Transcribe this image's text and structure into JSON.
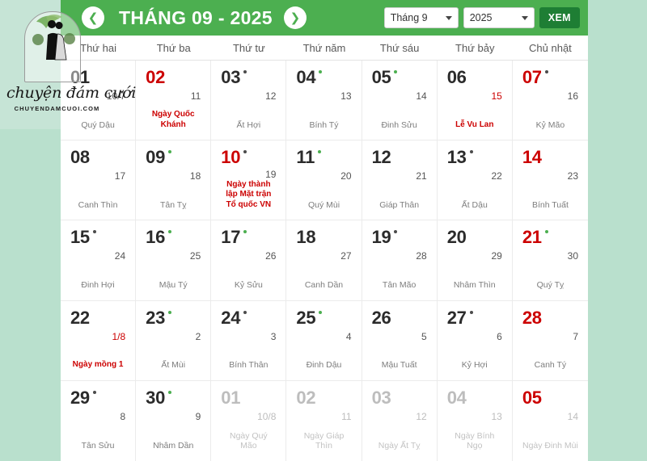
{
  "branding": {
    "script_name": "chuyện đám cưới",
    "website": "CHUYENDAMCUOI.COM",
    "logo_icon": "bride-groom-illustration-icon"
  },
  "header": {
    "title": "THÁNG 09 - 2025",
    "prev_icon": "chevron-left-icon",
    "next_icon": "chevron-right-icon",
    "month_select": "Tháng 9",
    "year_select": "2025",
    "view_button": "XEM",
    "accent_color": "#4caf50",
    "button_color": "#1e7e34"
  },
  "weekdays": [
    "Thứ hai",
    "Thứ ba",
    "Thứ tư",
    "Thứ năm",
    "Thứ sáu",
    "Thứ bảy",
    "Chủ nhật"
  ],
  "days": [
    {
      "solar": "01",
      "lunar": "10/7",
      "note": "Quý Dậu",
      "dot": "none",
      "red": false,
      "red_lunar": false,
      "other": false
    },
    {
      "solar": "02",
      "lunar": "11",
      "note": "Ngày Quốc Khánh",
      "dot": "none",
      "red": true,
      "red_lunar": false,
      "other": false,
      "holiday": true
    },
    {
      "solar": "03",
      "lunar": "12",
      "note": "Ất Hợi",
      "dot": "dark",
      "red": false,
      "red_lunar": false,
      "other": false
    },
    {
      "solar": "04",
      "lunar": "13",
      "note": "Bính Tý",
      "dot": "green",
      "red": false,
      "red_lunar": false,
      "other": false
    },
    {
      "solar": "05",
      "lunar": "14",
      "note": "Đinh Sửu",
      "dot": "green",
      "red": false,
      "red_lunar": false,
      "other": false
    },
    {
      "solar": "06",
      "lunar": "15",
      "note": "Lễ Vu Lan",
      "dot": "none",
      "red": false,
      "red_lunar": true,
      "other": false,
      "holiday": true
    },
    {
      "solar": "07",
      "lunar": "16",
      "note": "Kỷ Mão",
      "dot": "dark",
      "red": true,
      "red_lunar": false,
      "other": false
    },
    {
      "solar": "08",
      "lunar": "17",
      "note": "Canh Thìn",
      "dot": "none",
      "red": false,
      "red_lunar": false,
      "other": false
    },
    {
      "solar": "09",
      "lunar": "18",
      "note": "Tân Tỵ",
      "dot": "green",
      "red": false,
      "red_lunar": false,
      "other": false
    },
    {
      "solar": "10",
      "lunar": "19",
      "note": "Ngày thành lập Mặt trận Tổ quốc VN",
      "dot": "dark",
      "red": true,
      "red_lunar": false,
      "other": false,
      "holiday": true
    },
    {
      "solar": "11",
      "lunar": "20",
      "note": "Quý Mùi",
      "dot": "green",
      "red": false,
      "red_lunar": false,
      "other": false
    },
    {
      "solar": "12",
      "lunar": "21",
      "note": "Giáp Thân",
      "dot": "none",
      "red": false,
      "red_lunar": false,
      "other": false
    },
    {
      "solar": "13",
      "lunar": "22",
      "note": "Ất Dậu",
      "dot": "dark",
      "red": false,
      "red_lunar": false,
      "other": false
    },
    {
      "solar": "14",
      "lunar": "23",
      "note": "Bính Tuất",
      "dot": "none",
      "red": true,
      "red_lunar": false,
      "other": false
    },
    {
      "solar": "15",
      "lunar": "24",
      "note": "Đinh Hợi",
      "dot": "dark",
      "red": false,
      "red_lunar": false,
      "other": false
    },
    {
      "solar": "16",
      "lunar": "25",
      "note": "Mậu Tý",
      "dot": "green",
      "red": false,
      "red_lunar": false,
      "other": false
    },
    {
      "solar": "17",
      "lunar": "26",
      "note": "Kỷ Sửu",
      "dot": "green",
      "red": false,
      "red_lunar": false,
      "other": false
    },
    {
      "solar": "18",
      "lunar": "27",
      "note": "Canh Dần",
      "dot": "none",
      "red": false,
      "red_lunar": false,
      "other": false
    },
    {
      "solar": "19",
      "lunar": "28",
      "note": "Tân Mão",
      "dot": "dark",
      "red": false,
      "red_lunar": false,
      "other": false
    },
    {
      "solar": "20",
      "lunar": "29",
      "note": "Nhâm Thìn",
      "dot": "none",
      "red": false,
      "red_lunar": false,
      "other": false
    },
    {
      "solar": "21",
      "lunar": "30",
      "note": "Quý Tỵ",
      "dot": "green",
      "red": true,
      "red_lunar": false,
      "other": false
    },
    {
      "solar": "22",
      "lunar": "1/8",
      "note": "Ngày mồng 1",
      "dot": "none",
      "red": false,
      "red_lunar": true,
      "other": false,
      "holiday": true
    },
    {
      "solar": "23",
      "lunar": "2",
      "note": "Ất Mùi",
      "dot": "green",
      "red": false,
      "red_lunar": false,
      "other": false
    },
    {
      "solar": "24",
      "lunar": "3",
      "note": "Bính Thân",
      "dot": "dark",
      "red": false,
      "red_lunar": false,
      "other": false
    },
    {
      "solar": "25",
      "lunar": "4",
      "note": "Đinh Dậu",
      "dot": "green",
      "red": false,
      "red_lunar": false,
      "other": false
    },
    {
      "solar": "26",
      "lunar": "5",
      "note": "Mậu Tuất",
      "dot": "none",
      "red": false,
      "red_lunar": false,
      "other": false
    },
    {
      "solar": "27",
      "lunar": "6",
      "note": "Kỷ Hợi",
      "dot": "dark",
      "red": false,
      "red_lunar": false,
      "other": false
    },
    {
      "solar": "28",
      "lunar": "7",
      "note": "Canh Tý",
      "dot": "none",
      "red": true,
      "red_lunar": false,
      "other": false
    },
    {
      "solar": "29",
      "lunar": "8",
      "note": "Tân Sửu",
      "dot": "dark",
      "red": false,
      "red_lunar": false,
      "other": false
    },
    {
      "solar": "30",
      "lunar": "9",
      "note": "Nhâm Dần",
      "dot": "green",
      "red": false,
      "red_lunar": false,
      "other": false
    },
    {
      "solar": "01",
      "lunar": "10/8",
      "note": "Ngày Quý Mão",
      "dot": "none",
      "red": false,
      "red_lunar": false,
      "other": true
    },
    {
      "solar": "02",
      "lunar": "11",
      "note": "Ngày Giáp Thìn",
      "dot": "none",
      "red": false,
      "red_lunar": false,
      "other": true
    },
    {
      "solar": "03",
      "lunar": "12",
      "note": "Ngày Ất Tỵ",
      "dot": "none",
      "red": false,
      "red_lunar": false,
      "other": true
    },
    {
      "solar": "04",
      "lunar": "13",
      "note": "Ngày Bính Ngọ",
      "dot": "none",
      "red": false,
      "red_lunar": false,
      "other": true
    },
    {
      "solar": "05",
      "lunar": "14",
      "note": "Ngày Đinh Mùi",
      "dot": "none",
      "red": true,
      "red_lunar": false,
      "other": true
    }
  ]
}
